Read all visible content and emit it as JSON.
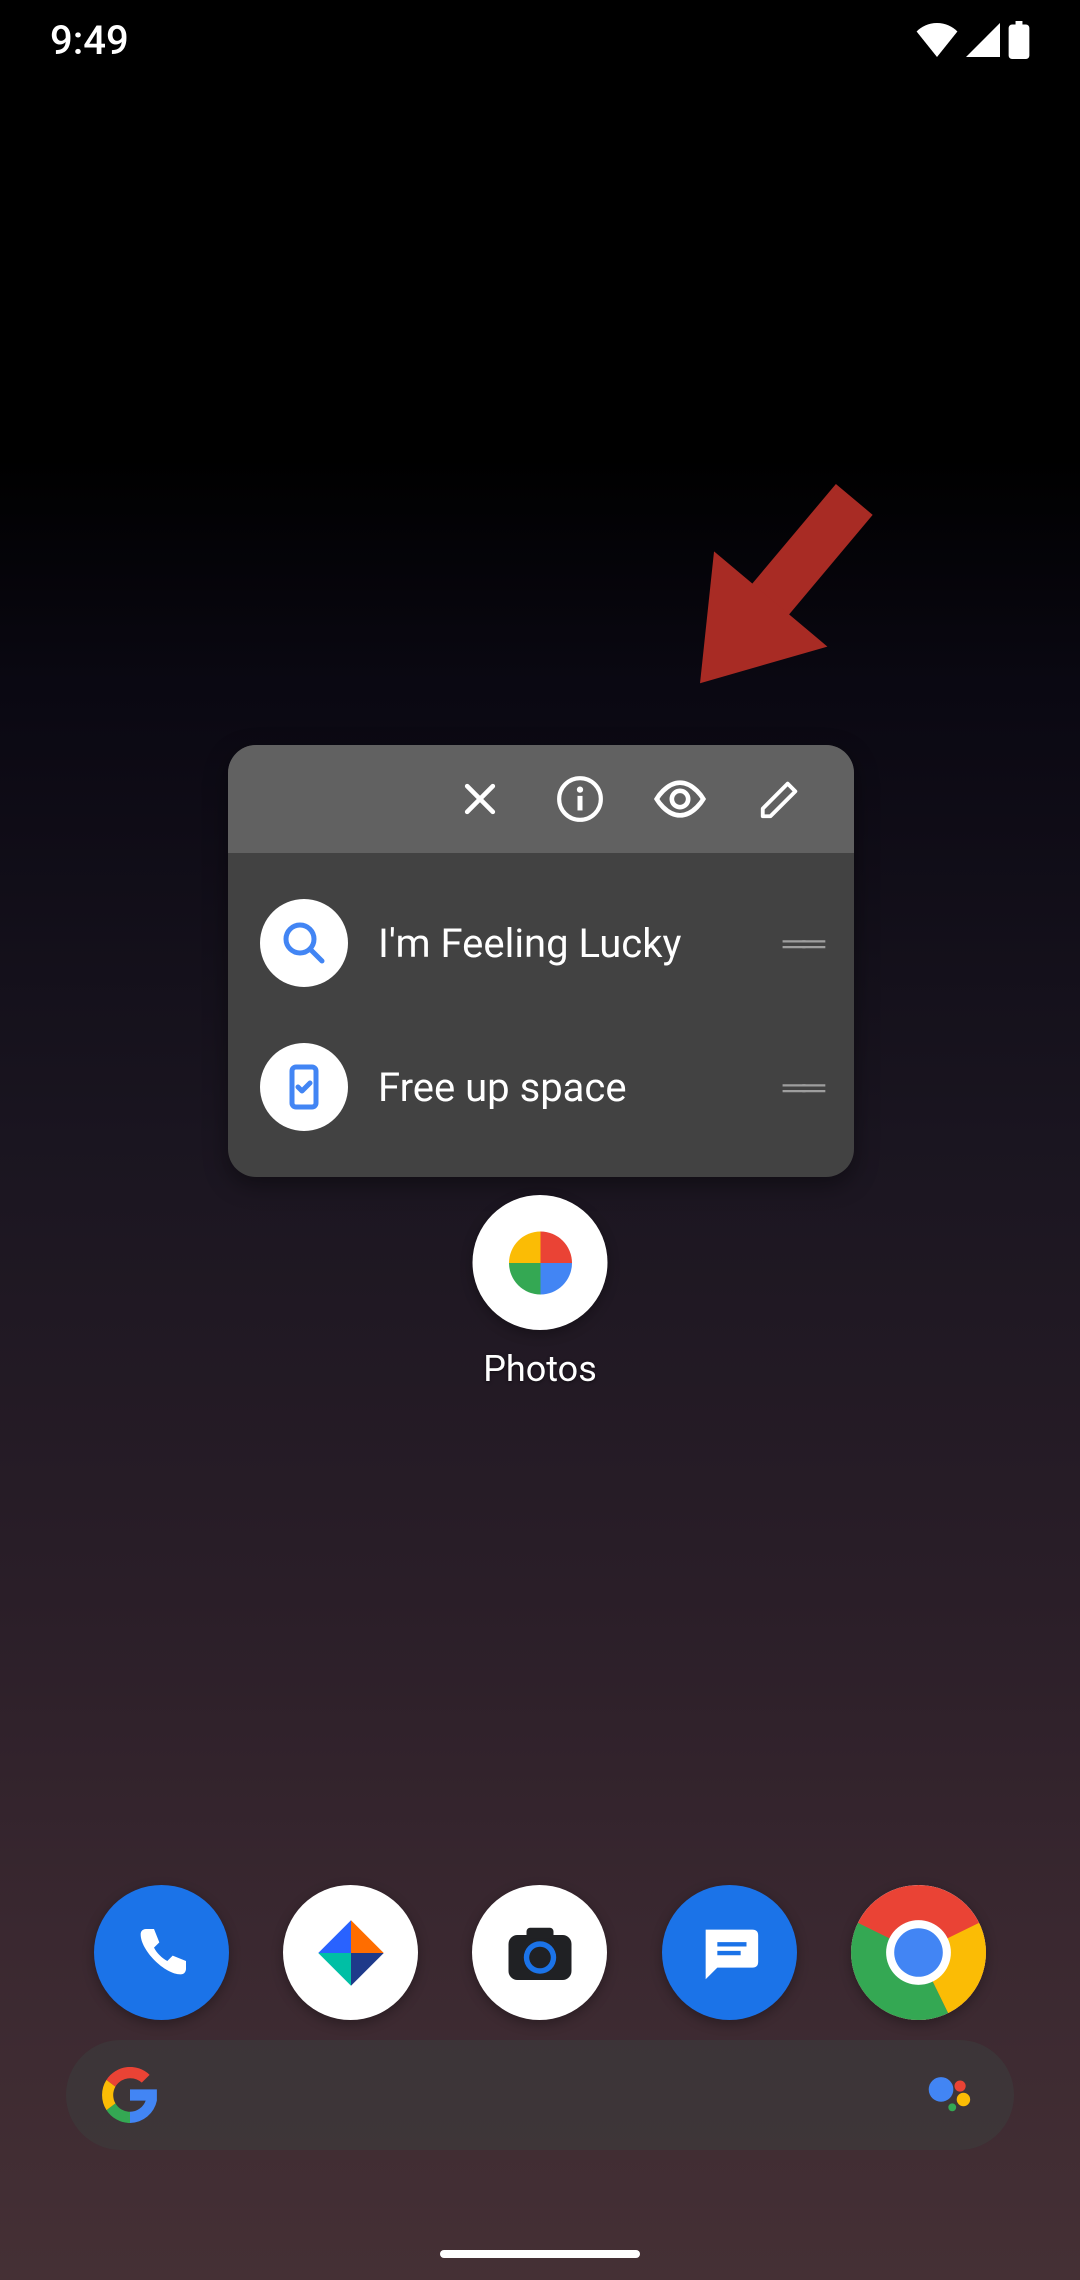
{
  "status": {
    "time": "9:49"
  },
  "popup": {
    "shortcuts": [
      {
        "label": "I'm Feeling Lucky",
        "icon": "search-icon"
      },
      {
        "label": "Free up space",
        "icon": "phone-check-icon"
      }
    ]
  },
  "app": {
    "label": "Photos"
  },
  "colors": {
    "google_blue": "#4285F4",
    "google_red": "#EA4335",
    "google_yellow": "#FBBC05",
    "google_green": "#34A853",
    "arrow": "#A82B24"
  }
}
